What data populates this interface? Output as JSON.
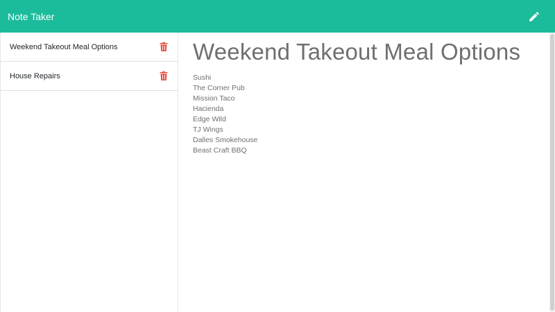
{
  "app": {
    "brand": "Note Taker",
    "accent_color": "#1abc9c",
    "delete_color": "#e74c3c"
  },
  "header": {
    "new_note_icon": "pencil-icon"
  },
  "sidebar": {
    "notes": [
      {
        "title": "Weekend Takeout Meal Options",
        "delete_icon": "trash-icon"
      },
      {
        "title": "House Repairs",
        "delete_icon": "trash-icon"
      }
    ]
  },
  "editor": {
    "title": "Weekend Takeout Meal Options",
    "lines": [
      "Sushi",
      "The Corner Pub",
      "Mission Taco",
      "Hacienda",
      "Edge Wild",
      "TJ Wings",
      "Dalles Smokehouse",
      "Beast Craft BBQ"
    ]
  }
}
